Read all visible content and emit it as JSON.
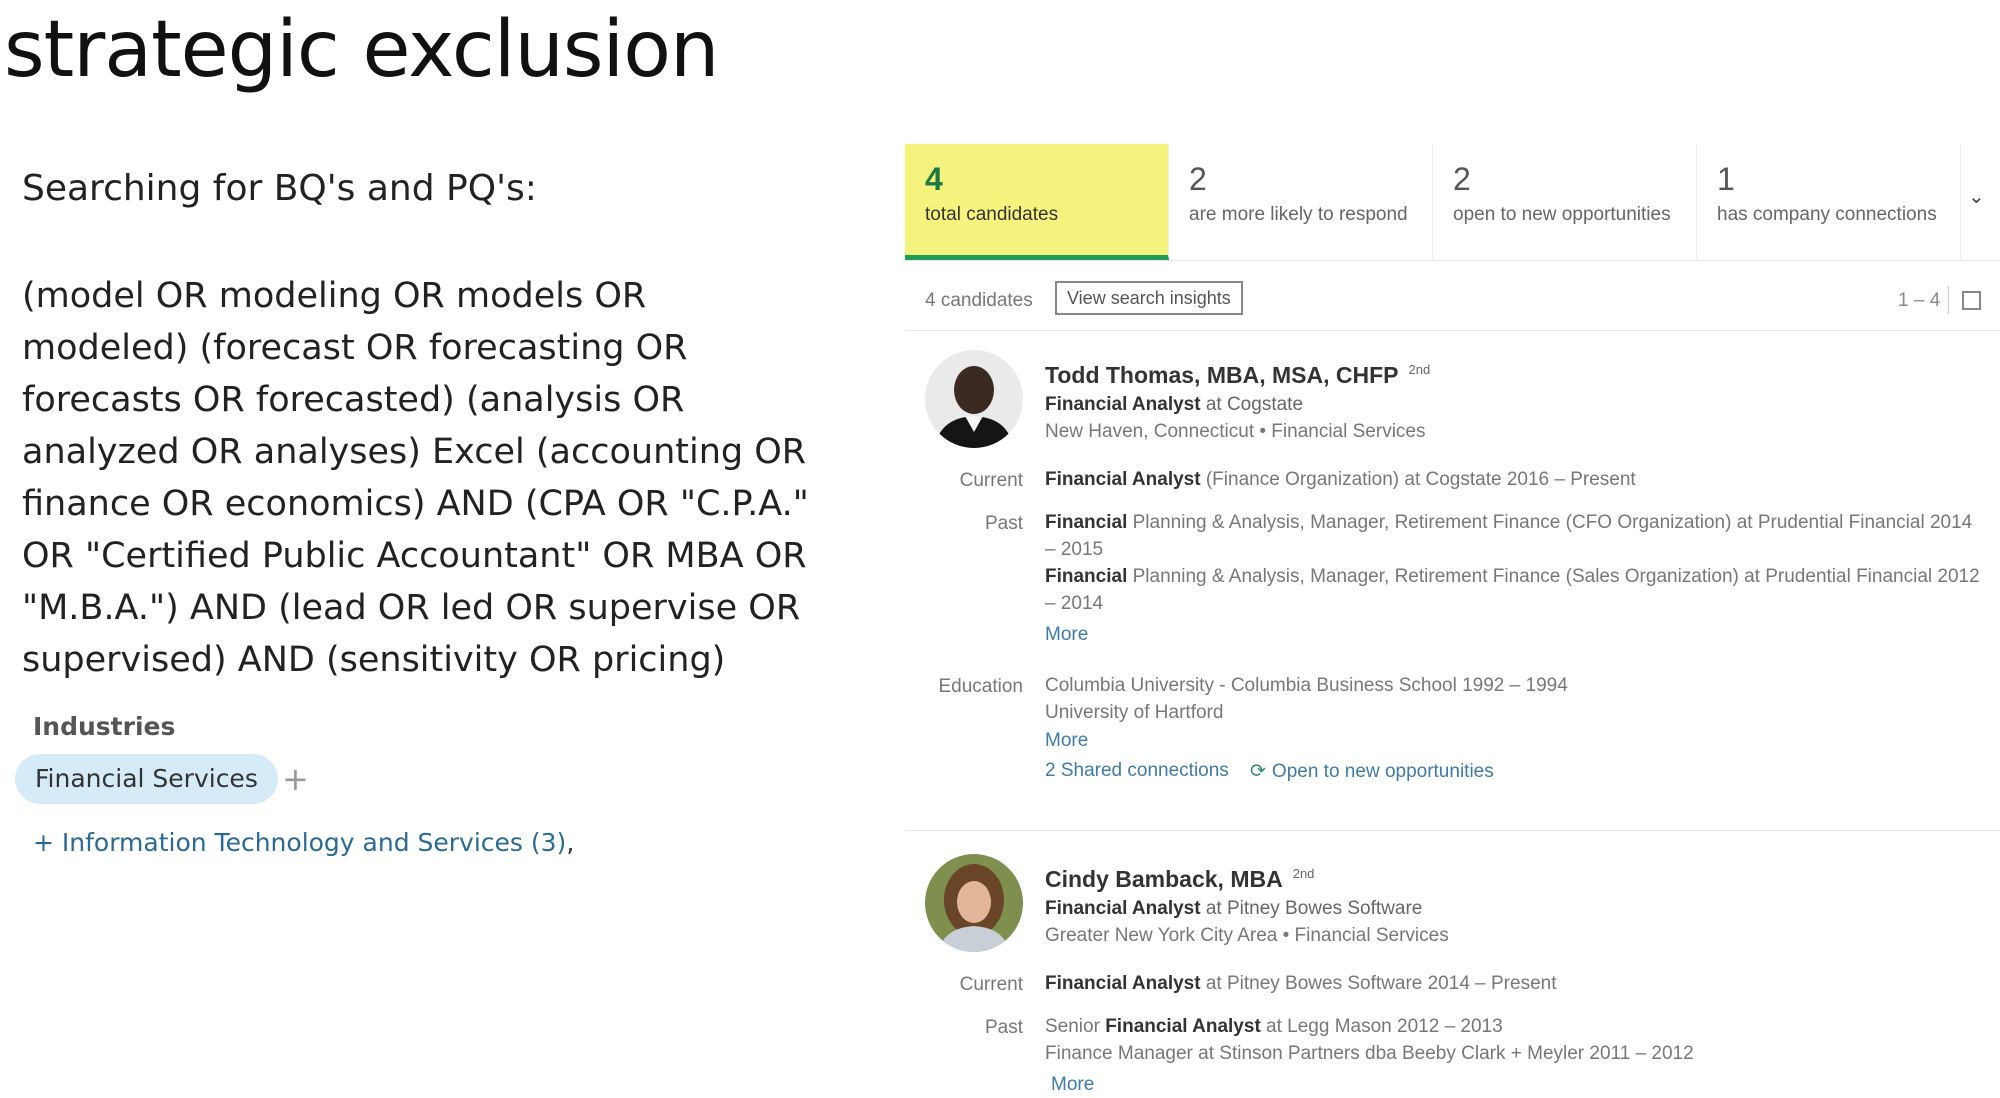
{
  "slide": {
    "title": "strategic exclusion",
    "search_heading": "Searching for BQ's and PQ's:",
    "query_text": "(model OR modeling OR models OR modeled) (forecast OR forecasting OR forecasts OR forecasted) (analysis OR analyzed OR analyses) Excel (accounting OR finance OR economics) AND (CPA OR \"C.P.A.\" OR \"Certified Public Accountant\" OR MBA OR \"M.B.A.\") AND (lead OR led OR supervise OR supervised) AND (sensitivity OR pricing)",
    "industries_label": "Industries",
    "industry_chip": "Financial Services",
    "industry_add": "+",
    "industry_suggestion": "+ Information Technology and Services (3)",
    "industry_suggestion_suffix": ","
  },
  "stats": [
    {
      "num": "4",
      "label": "total candidates",
      "active": true
    },
    {
      "num": "2",
      "label": "are more likely to respond",
      "active": false
    },
    {
      "num": "2",
      "label": "open to new opportunities",
      "active": false
    },
    {
      "num": "1",
      "label": "has company connections",
      "active": false
    }
  ],
  "stats_chevron": "⌄",
  "results": {
    "count": "4 candidates",
    "insights_button": "View search insights",
    "range": "1 – 4"
  },
  "candidates": [
    {
      "name": "Todd Thomas, MBA, MSA, CHFP",
      "degree": "2nd",
      "headline_title": "Financial Analyst",
      "headline_company": " at Cogstate",
      "location": "New Haven, Connecticut • Financial Services",
      "current_label": "Current",
      "current_bold": "Financial Analyst",
      "current_rest": " (Finance Organization) at Cogstate  2016 – Present",
      "past_label": "Past",
      "past1_bold": "Financial",
      "past1_rest": " Planning & Analysis, Manager, Retirement Finance (CFO Organization) at Prudential Financial  2014 – 2015",
      "past2_bold": "Financial",
      "past2_rest": " Planning & Analysis, Manager, Retirement Finance (Sales Organization) at Prudential Financial  2012 – 2014",
      "more_past": "More",
      "education_label": "Education",
      "edu1": "Columbia University - Columbia Business School  1992 – 1994",
      "edu2": "University of Hartford",
      "more_edu": "More",
      "shared": "2 Shared connections",
      "open": "Open to new opportunities"
    },
    {
      "name": "Cindy Bamback, MBA",
      "degree": "2nd",
      "headline_title": "Financial Analyst",
      "headline_company": " at Pitney Bowes Software",
      "location": "Greater New York City Area • Financial Services",
      "current_label": "Current",
      "current_bold": "Financial Analyst",
      "current_rest": " at Pitney Bowes Software  2014 – Present",
      "past_label": "Past",
      "past1_pre": "Senior ",
      "past1_bold": "Financial Analyst",
      "past1_rest": " at Legg Mason  2012 – 2013",
      "past2": "Finance Manager at Stinson Partners dba Beeby Clark + Meyler  2011 – 2012",
      "more_past": "More"
    }
  ],
  "colors": {
    "active_tab_bg": "#f5f37e",
    "active_tab_border": "#1f9b55",
    "link": "#3e7ba8",
    "chip_bg": "#d5ecf8"
  }
}
